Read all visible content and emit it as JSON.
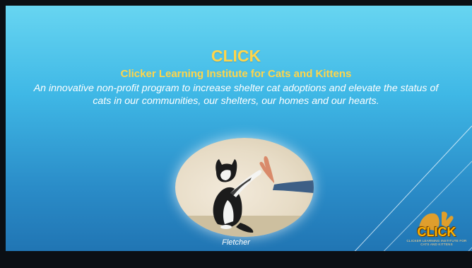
{
  "slide": {
    "title": "CLICK",
    "subtitle": "Clicker Learning Institute for Cats and Kittens",
    "description": "An innovative non-profit program to increase shelter cat adoptions and elevate the status of cats in our communities, our shelters, our homes and our hearts.",
    "photo_caption": "Fletcher",
    "logo_text": "CLICK",
    "logo_subtext": "CLICKER LEARNING INSTITUTE FOR CATS AND KITTENS"
  },
  "colors": {
    "title": "#ffd54a",
    "background_top": "#6ad7f2",
    "background_bottom": "#1e6fae",
    "text": "#ffffff"
  },
  "icons": [
    "cat-high-five-photo",
    "click-logo-icon"
  ]
}
